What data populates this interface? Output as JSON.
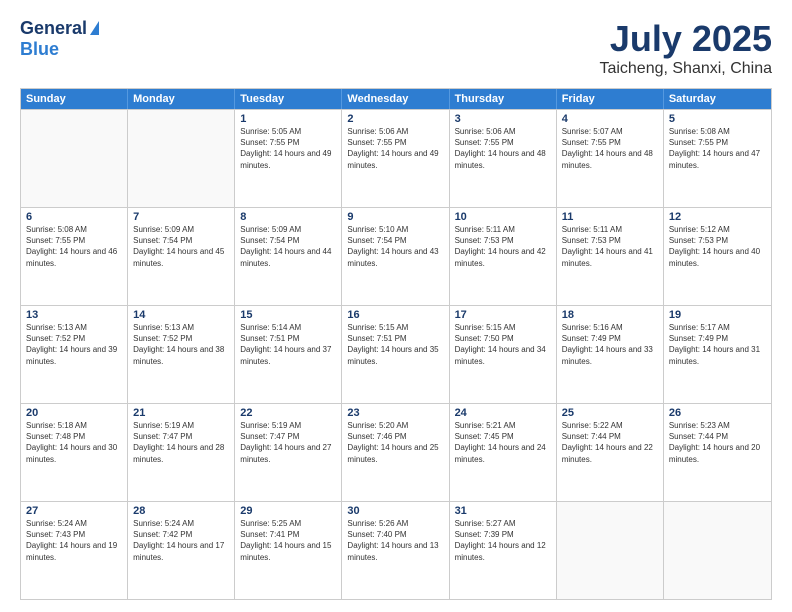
{
  "header": {
    "logo_line1": "General",
    "logo_line2": "Blue",
    "main_title": "July 2025",
    "subtitle": "Taicheng, Shanxi, China"
  },
  "weekdays": [
    "Sunday",
    "Monday",
    "Tuesday",
    "Wednesday",
    "Thursday",
    "Friday",
    "Saturday"
  ],
  "rows": [
    [
      {
        "day": "",
        "info": ""
      },
      {
        "day": "",
        "info": ""
      },
      {
        "day": "1",
        "info": "Sunrise: 5:05 AM\nSunset: 7:55 PM\nDaylight: 14 hours and 49 minutes."
      },
      {
        "day": "2",
        "info": "Sunrise: 5:06 AM\nSunset: 7:55 PM\nDaylight: 14 hours and 49 minutes."
      },
      {
        "day": "3",
        "info": "Sunrise: 5:06 AM\nSunset: 7:55 PM\nDaylight: 14 hours and 48 minutes."
      },
      {
        "day": "4",
        "info": "Sunrise: 5:07 AM\nSunset: 7:55 PM\nDaylight: 14 hours and 48 minutes."
      },
      {
        "day": "5",
        "info": "Sunrise: 5:08 AM\nSunset: 7:55 PM\nDaylight: 14 hours and 47 minutes."
      }
    ],
    [
      {
        "day": "6",
        "info": "Sunrise: 5:08 AM\nSunset: 7:55 PM\nDaylight: 14 hours and 46 minutes."
      },
      {
        "day": "7",
        "info": "Sunrise: 5:09 AM\nSunset: 7:54 PM\nDaylight: 14 hours and 45 minutes."
      },
      {
        "day": "8",
        "info": "Sunrise: 5:09 AM\nSunset: 7:54 PM\nDaylight: 14 hours and 44 minutes."
      },
      {
        "day": "9",
        "info": "Sunrise: 5:10 AM\nSunset: 7:54 PM\nDaylight: 14 hours and 43 minutes."
      },
      {
        "day": "10",
        "info": "Sunrise: 5:11 AM\nSunset: 7:53 PM\nDaylight: 14 hours and 42 minutes."
      },
      {
        "day": "11",
        "info": "Sunrise: 5:11 AM\nSunset: 7:53 PM\nDaylight: 14 hours and 41 minutes."
      },
      {
        "day": "12",
        "info": "Sunrise: 5:12 AM\nSunset: 7:53 PM\nDaylight: 14 hours and 40 minutes."
      }
    ],
    [
      {
        "day": "13",
        "info": "Sunrise: 5:13 AM\nSunset: 7:52 PM\nDaylight: 14 hours and 39 minutes."
      },
      {
        "day": "14",
        "info": "Sunrise: 5:13 AM\nSunset: 7:52 PM\nDaylight: 14 hours and 38 minutes."
      },
      {
        "day": "15",
        "info": "Sunrise: 5:14 AM\nSunset: 7:51 PM\nDaylight: 14 hours and 37 minutes."
      },
      {
        "day": "16",
        "info": "Sunrise: 5:15 AM\nSunset: 7:51 PM\nDaylight: 14 hours and 35 minutes."
      },
      {
        "day": "17",
        "info": "Sunrise: 5:15 AM\nSunset: 7:50 PM\nDaylight: 14 hours and 34 minutes."
      },
      {
        "day": "18",
        "info": "Sunrise: 5:16 AM\nSunset: 7:49 PM\nDaylight: 14 hours and 33 minutes."
      },
      {
        "day": "19",
        "info": "Sunrise: 5:17 AM\nSunset: 7:49 PM\nDaylight: 14 hours and 31 minutes."
      }
    ],
    [
      {
        "day": "20",
        "info": "Sunrise: 5:18 AM\nSunset: 7:48 PM\nDaylight: 14 hours and 30 minutes."
      },
      {
        "day": "21",
        "info": "Sunrise: 5:19 AM\nSunset: 7:47 PM\nDaylight: 14 hours and 28 minutes."
      },
      {
        "day": "22",
        "info": "Sunrise: 5:19 AM\nSunset: 7:47 PM\nDaylight: 14 hours and 27 minutes."
      },
      {
        "day": "23",
        "info": "Sunrise: 5:20 AM\nSunset: 7:46 PM\nDaylight: 14 hours and 25 minutes."
      },
      {
        "day": "24",
        "info": "Sunrise: 5:21 AM\nSunset: 7:45 PM\nDaylight: 14 hours and 24 minutes."
      },
      {
        "day": "25",
        "info": "Sunrise: 5:22 AM\nSunset: 7:44 PM\nDaylight: 14 hours and 22 minutes."
      },
      {
        "day": "26",
        "info": "Sunrise: 5:23 AM\nSunset: 7:44 PM\nDaylight: 14 hours and 20 minutes."
      }
    ],
    [
      {
        "day": "27",
        "info": "Sunrise: 5:24 AM\nSunset: 7:43 PM\nDaylight: 14 hours and 19 minutes."
      },
      {
        "day": "28",
        "info": "Sunrise: 5:24 AM\nSunset: 7:42 PM\nDaylight: 14 hours and 17 minutes."
      },
      {
        "day": "29",
        "info": "Sunrise: 5:25 AM\nSunset: 7:41 PM\nDaylight: 14 hours and 15 minutes."
      },
      {
        "day": "30",
        "info": "Sunrise: 5:26 AM\nSunset: 7:40 PM\nDaylight: 14 hours and 13 minutes."
      },
      {
        "day": "31",
        "info": "Sunrise: 5:27 AM\nSunset: 7:39 PM\nDaylight: 14 hours and 12 minutes."
      },
      {
        "day": "",
        "info": ""
      },
      {
        "day": "",
        "info": ""
      }
    ]
  ]
}
